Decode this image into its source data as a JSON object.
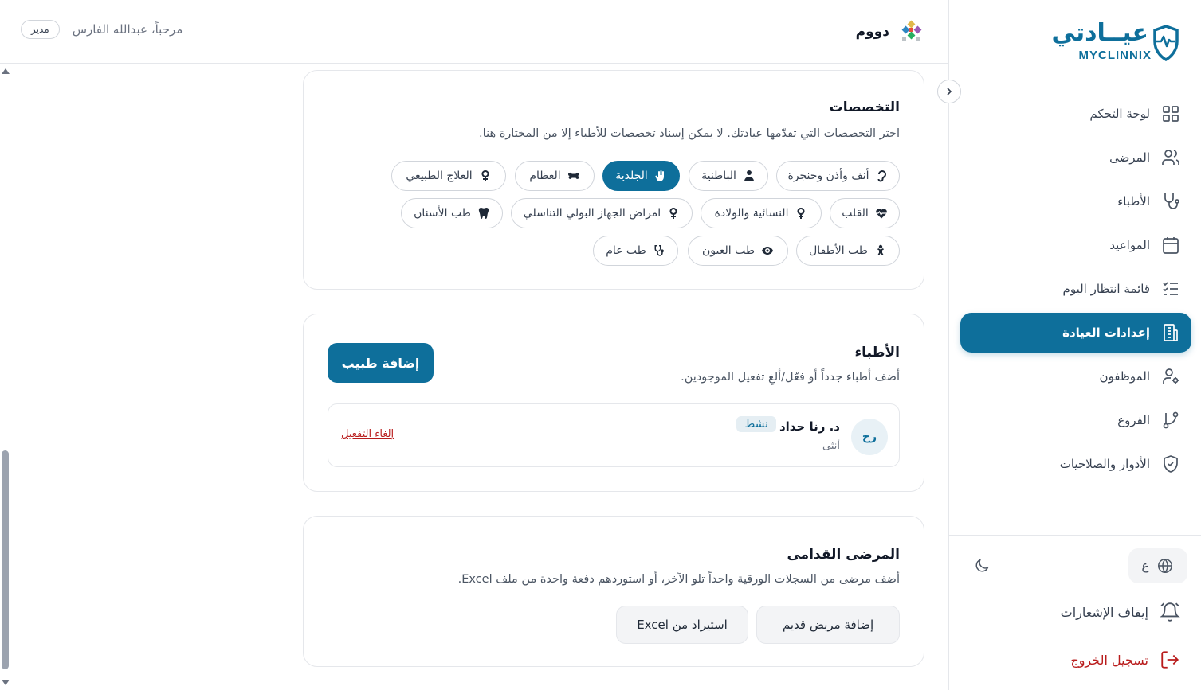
{
  "brand": {
    "name_ar": "عيــادتي",
    "name_en": "MYCLINNIX"
  },
  "topbar": {
    "clinic_name": "دووم",
    "greeting": "مرحباً، عبدالله الفارس",
    "role": "مدير"
  },
  "sidebar": {
    "items": [
      {
        "label": "لوحة التحكم",
        "icon": "dashboard-icon",
        "active": false
      },
      {
        "label": "المرضى",
        "icon": "patients-icon",
        "active": false
      },
      {
        "label": "الأطباء",
        "icon": "stethoscope-icon",
        "active": false
      },
      {
        "label": "المواعيد",
        "icon": "calendar-icon",
        "active": false
      },
      {
        "label": "قائمة انتظار اليوم",
        "icon": "checklist-icon",
        "active": false
      },
      {
        "label": "إعدادات العيادة",
        "icon": "building-icon",
        "active": true
      },
      {
        "label": "الموظفون",
        "icon": "user-gear-icon",
        "active": false
      },
      {
        "label": "الفروع",
        "icon": "branch-icon",
        "active": false
      },
      {
        "label": "الأدوار والصلاحيات",
        "icon": "shield-icon",
        "active": false
      }
    ],
    "language_label": "ع",
    "notifications_label": "إيقاف الإشعارات",
    "logout_label": "تسجيل الخروج"
  },
  "specialties": {
    "title": "التخصصات",
    "description": "اختر التخصصات التي تقدّمها عيادتك. لا يمكن إسناد تخصصات للأطباء إلا من المختارة هنا.",
    "chips": [
      {
        "label": "أنف وأذن وحنجرة",
        "icon": "ear-icon",
        "selected": false
      },
      {
        "label": "الباطنية",
        "icon": "doctor-icon",
        "selected": false
      },
      {
        "label": "الجلدية",
        "icon": "hand-icon",
        "selected": true
      },
      {
        "label": "العظام",
        "icon": "bone-icon",
        "selected": false
      },
      {
        "label": "العلاج الطبيعي",
        "icon": "female-icon",
        "selected": false
      },
      {
        "label": "القلب",
        "icon": "heart-pulse-icon",
        "selected": false
      },
      {
        "label": "النسائية والولادة",
        "icon": "female-icon",
        "selected": false
      },
      {
        "label": "امراض الجهاز البولي التناسلي",
        "icon": "female-icon",
        "selected": false
      },
      {
        "label": "طب الأسنان",
        "icon": "tooth-icon",
        "selected": false
      },
      {
        "label": "طب الأطفال",
        "icon": "baby-icon",
        "selected": false
      },
      {
        "label": "طب العيون",
        "icon": "eye-icon",
        "selected": false
      },
      {
        "label": "طب عام",
        "icon": "stethoscope-icon",
        "selected": false
      }
    ]
  },
  "doctors": {
    "title": "الأطباء",
    "description": "أضف أطباء جدداً أو فعّل/ألغِ تفعيل الموجودين.",
    "add_button": "إضافة طبيب",
    "list": [
      {
        "initials": "رح",
        "name": "د. رنا حداد",
        "status": "نشط",
        "gender": "أنثى",
        "action": "إلغاء التفعيل"
      }
    ]
  },
  "old_patients": {
    "title": "المرضى القدامى",
    "description": "أضف مرضى من السجلات الورقية واحداً تلو الآخر، أو استوردهم دفعة واحدة من ملف Excel.",
    "add_button": "إضافة مريض قديم",
    "import_button": "استيراد من Excel"
  },
  "colors": {
    "primary": "#0e6f9b",
    "danger": "#b91c1c",
    "border": "#e5e7eb"
  }
}
